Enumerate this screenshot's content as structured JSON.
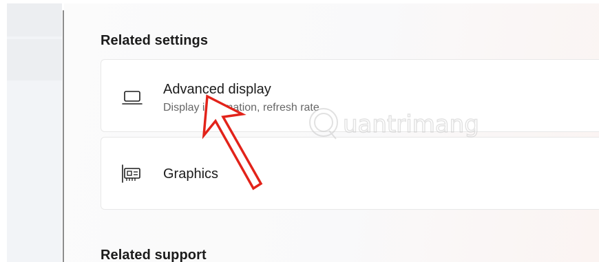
{
  "sections": {
    "related_settings_title": "Related settings",
    "related_support_title": "Related support"
  },
  "cards": {
    "advanced_display": {
      "title": "Advanced display",
      "subtitle": "Display information, refresh rate",
      "icon": "laptop-icon"
    },
    "graphics": {
      "title": "Graphics",
      "icon": "graphics-card-icon"
    }
  },
  "watermark": {
    "brand": "Quantrimang"
  },
  "annotation": {
    "color": "#e2231a"
  }
}
